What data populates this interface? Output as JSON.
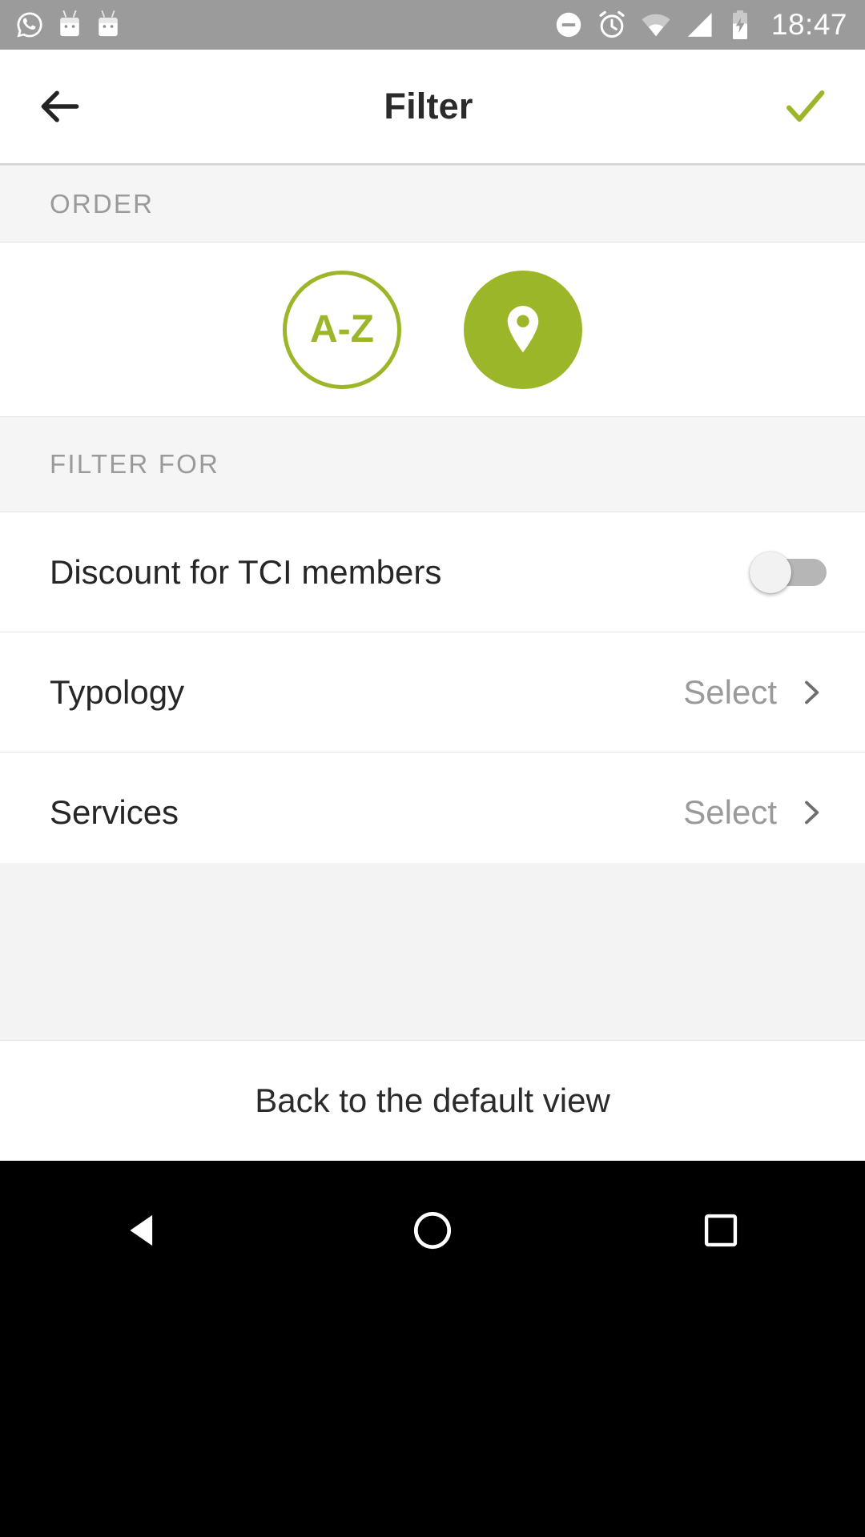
{
  "status_bar": {
    "time": "18:47",
    "left_icons": [
      "whatsapp-icon",
      "android-notification-icon",
      "android-notification-icon"
    ],
    "right_icons": [
      "do-not-disturb-icon",
      "alarm-icon",
      "wifi-icon",
      "cellular-signal-icon",
      "battery-charging-icon"
    ],
    "background_color": "#9b9b9b"
  },
  "app_bar": {
    "title": "Filter",
    "back_icon": "arrow-left-icon",
    "confirm_icon": "check-icon",
    "confirm_color": "#9cb62a"
  },
  "order": {
    "header": "ORDER",
    "options": [
      {
        "id": "alphabetical",
        "label": "A-Z",
        "icon": "az-text",
        "selected": false
      },
      {
        "id": "by-location",
        "label": "",
        "icon": "map-pin-icon",
        "selected": true
      }
    ],
    "accent_color": "#9cb62a"
  },
  "filter_for": {
    "header": "FILTER FOR",
    "rows": [
      {
        "label": "Discount for TCI members",
        "control": "toggle",
        "value": "off"
      },
      {
        "label": "Typology",
        "control": "chevron",
        "value": "Select"
      },
      {
        "label": "Services",
        "control": "chevron",
        "value": "Select"
      }
    ]
  },
  "footer": {
    "reset_label": "Back to the default view"
  },
  "nav_bar": {
    "buttons": [
      "back-triangle-icon",
      "home-circle-icon",
      "recents-square-icon"
    ]
  }
}
